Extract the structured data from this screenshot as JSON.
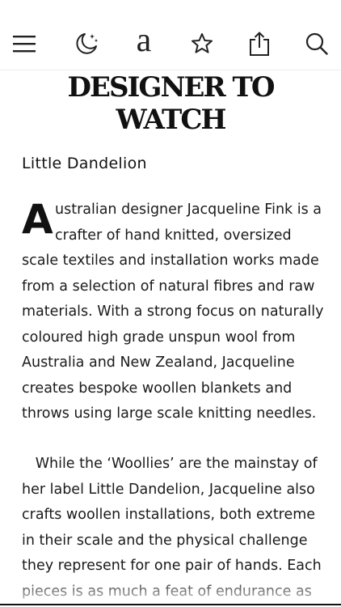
{
  "toolbar": {
    "menu_icon": "hamburger-menu-icon",
    "night_mode_icon": "moon-stars-icon",
    "font_glyph": "a",
    "bookmark_icon": "star-icon",
    "share_icon": "share-icon",
    "search_icon": "magnifier-icon"
  },
  "article": {
    "headline_line1": "DESIGNER TO",
    "headline_line2": "WATCH",
    "subheading": "Little Dandelion",
    "p1_dropcap": "A",
    "p1_lines": [
      "ustralian designer Jacqueline Fink is a",
      "crafter of hand knitted, oversized",
      "scale textiles and installation works made",
      "from a selection of natural fibres and raw",
      "materials. With a strong focus on naturally",
      "coloured high grade unspun wool from",
      "Australia and New Zealand, Jacqueline",
      "creates bespoke woollen blankets and",
      "throws using large scale knitting needles."
    ],
    "p2_lines": [
      "   While the ‘Woollies’ are the mainstay of",
      "her label Little Dandelion, Jacqueline also",
      "crafts woollen installations, both extreme",
      "in their scale and the physical challenge",
      "they represent for one pair of hands. Each",
      "pieces is as much a feat of endurance as"
    ]
  },
  "colors": {
    "text": "#111111",
    "background": "#ffffff"
  }
}
